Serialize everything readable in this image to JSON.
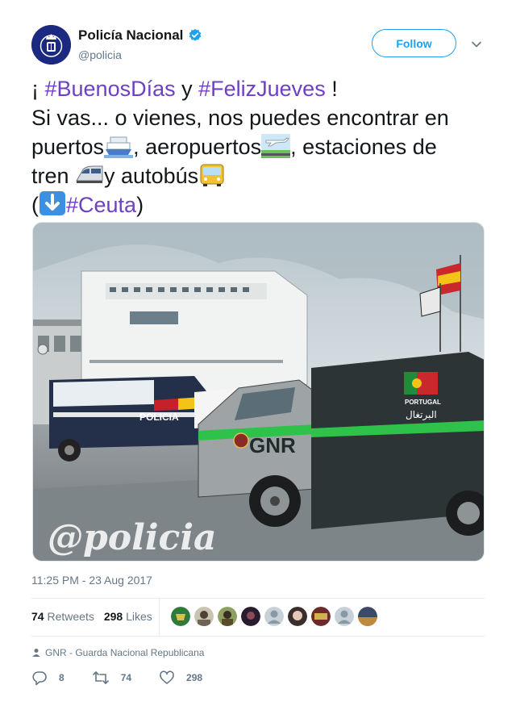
{
  "author": {
    "display_name": "Policía Nacional",
    "handle": "@policia",
    "verified": true
  },
  "follow_label": "Follow",
  "tweet": {
    "line1_pre": "¡ ",
    "hashtag1": "#BuenosDías",
    "line1_mid": " y ",
    "hashtag2": "#FelizJueves",
    "line1_post": " !",
    "line2": "Si vas... o vienes, nos puedes encontrar en",
    "line3_a": "puertos",
    "line3_b": ", aeropuertos",
    "line3_c": ", estaciones de",
    "line4_a": "tren ",
    "line4_b": "y autobús",
    "line5_open": "(",
    "hashtag3": "#Ceuta",
    "line5_close": ")"
  },
  "photo": {
    "watermark": "@policia",
    "van_label": "POLICIA",
    "gnr_label": "GNR",
    "portugal_label": "PORTUGAL",
    "portugal_arabic": "البرتغال"
  },
  "timestamp": "11:25 PM - 23 Aug 2017",
  "stats": {
    "retweets_count": "74",
    "retweets_label": "Retweets",
    "likes_count": "298",
    "likes_label": "Likes"
  },
  "location": "GNR - Guarda Nacional Republicana",
  "actions": {
    "replies": "8",
    "retweets": "74",
    "likes": "298"
  },
  "colors": {
    "hashtag": "#6f3fc4",
    "accent": "#1da1f2",
    "muted": "#657786"
  }
}
